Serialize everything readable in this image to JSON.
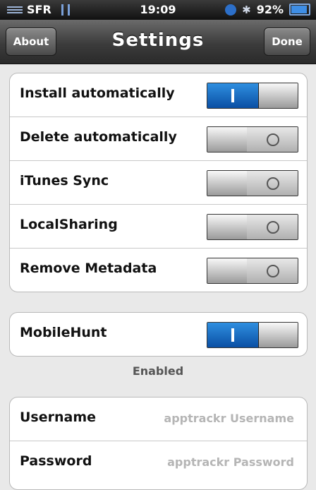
{
  "status_bar": {
    "carrier": "SFR",
    "time": "19:09",
    "battery": "92%",
    "battery_level": 0.92
  },
  "nav": {
    "title": "Settings",
    "about_label": "About",
    "done_label": "Done"
  },
  "settings": [
    {
      "label": "Install automatically",
      "on": true
    },
    {
      "label": "Delete automatically",
      "on": false
    },
    {
      "label": "iTunes Sync",
      "on": false
    },
    {
      "label": "LocalSharing",
      "on": false
    },
    {
      "label": "Remove Metadata",
      "on": false
    }
  ],
  "mobilehunt": {
    "label": "MobileHunt",
    "on": true,
    "footer": "Enabled"
  },
  "account": {
    "username_label": "Username",
    "username_placeholder": "apptrackr Username",
    "password_label": "Password",
    "password_placeholder": "apptrackr Password"
  },
  "colors": {
    "toggle_on": "#1a6cc4",
    "nav_bg": "#3c3c3c"
  }
}
